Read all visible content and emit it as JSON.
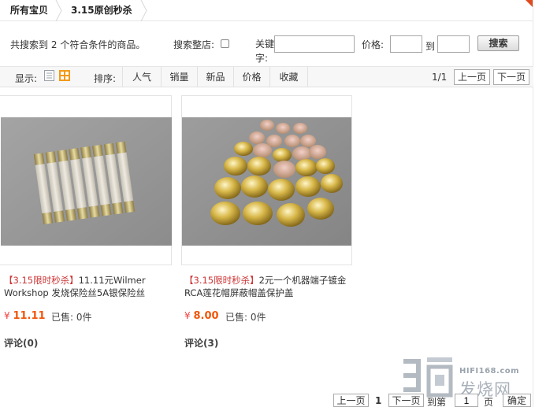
{
  "breadcrumb": {
    "root": "所有宝贝",
    "current": "3.15原创秒杀"
  },
  "search": {
    "result_prefix": "共搜索到",
    "result_count": "2",
    "result_suffix": "个符合条件的商品。",
    "whole_store_label": "搜索整店:",
    "keyword_label_1": "关键",
    "keyword_label_2": "字:",
    "keyword_value": "",
    "price_label": "价格:",
    "price_min": "",
    "to_label": "到",
    "price_max": "",
    "search_button": "搜索"
  },
  "sortbar": {
    "display_label": "显示:",
    "sort_label": "排序:",
    "options": [
      "人气",
      "销量",
      "新品",
      "价格",
      "收藏"
    ],
    "page_indicator": "1/1",
    "prev_label": "上一页",
    "next_label": "下一页"
  },
  "products": [
    {
      "tag": "【3.15限时秒杀】",
      "title": "11.11元Wilmer Workshop 发烧保险丝5A银保险丝",
      "currency": "¥",
      "price": "11.11",
      "sold": "已售: 0件",
      "reviews": "评论(0)"
    },
    {
      "tag": "【3.15限时秒杀】",
      "title": "2元一个机器端子镀金RCA莲花帽屏蔽帽盖保护盖",
      "currency": "¥",
      "price": "8.00",
      "sold": "已售: 0件",
      "reviews": "评论(3)"
    }
  ],
  "pager": {
    "prev_label": "上一页",
    "current_page": "1",
    "next_label": "下一页",
    "goto_label": "到第",
    "goto_value": "1",
    "page_unit": "页",
    "confirm_label": "确定"
  },
  "watermark": {
    "url": "HIFI168.com",
    "text": "发烧网"
  },
  "colors": {
    "accent": "#f0560b",
    "corner": "#e04a1f",
    "tag": "#cc3333",
    "icon_orange": "#f29a18"
  }
}
